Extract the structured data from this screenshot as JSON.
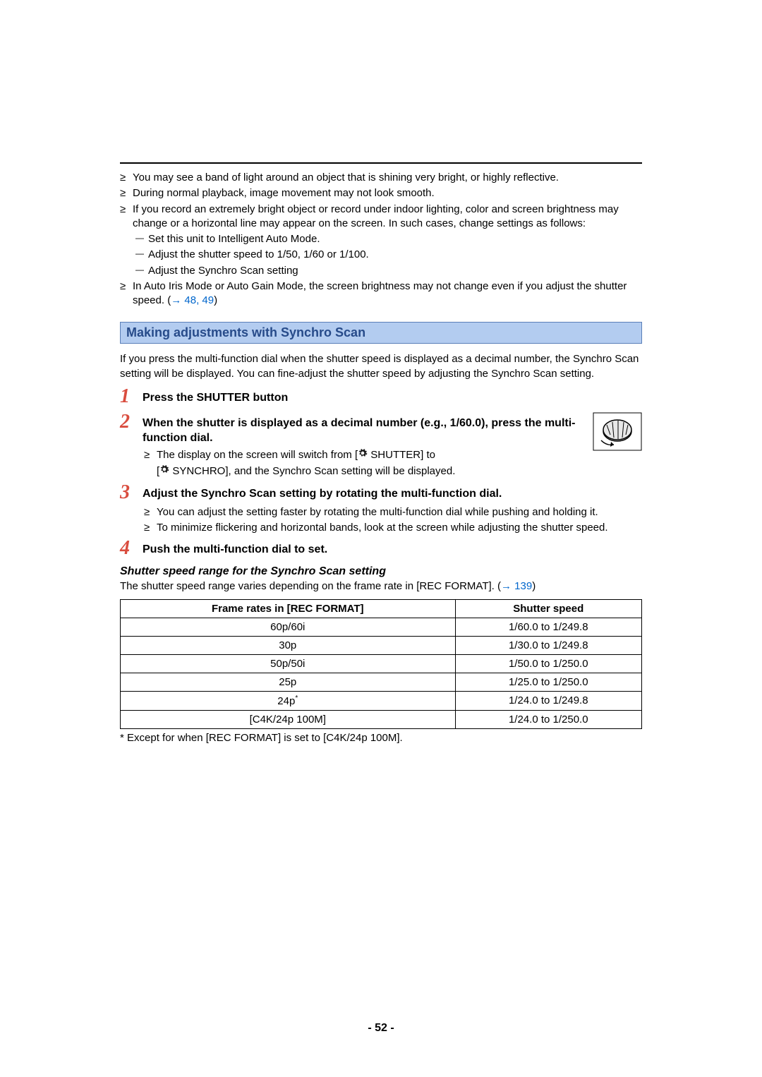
{
  "top_bullets": {
    "b1": "You may see a band of light around an object that is shining very bright, or highly reflective.",
    "b2": "During normal playback, image movement may not look smooth.",
    "b3": "If you record an extremely bright object or record under indoor lighting, color and screen brightness may change or a horizontal line may appear on the screen. In such cases, change settings as follows:",
    "b3a": "Set this unit to Intelligent Auto Mode.",
    "b3b": "Adjust the shutter speed to 1/50, 1/60 or 1/100.",
    "b3c": "Adjust the Synchro Scan setting",
    "b4": "In Auto Iris Mode or Auto Gain Mode, the screen brightness may not change even if you adjust the shutter speed. (",
    "b4_ref1": "48",
    "b4_sep": ", ",
    "b4_ref2": "49",
    "b4_close": ")",
    "arrow": "→ "
  },
  "section_heading": "Making adjustments with Synchro Scan",
  "section_para": "If you press the multi-function dial when the shutter speed is displayed as a decimal number, the Synchro Scan setting will be displayed. You can fine-adjust the shutter speed by adjusting the Synchro Scan setting.",
  "steps": {
    "n1": "1",
    "t1": "Press the SHUTTER button",
    "n2": "2",
    "t2": "When the shutter is displayed as a decimal number (e.g., 1/60.0), press the multi-function dial.",
    "s2a_pre": "The display on the screen will switch from [",
    "s2a_label": " SHUTTER] to",
    "s2b_pre": "[",
    "s2b_label": " SYNCHRO], and the Synchro Scan setting will be displayed.",
    "n3": "3",
    "t3": "Adjust the Synchro Scan setting by rotating the multi-function dial.",
    "s3a": "You can adjust the setting faster by rotating the multi-function dial while pushing and holding it.",
    "s3b": "To minimize flickering and horizontal bands, look at the screen while adjusting the shutter speed.",
    "n4": "4",
    "t4": "Push the multi-function dial to set."
  },
  "subheading": "Shutter speed range for the Synchro Scan setting",
  "sub_para": "The shutter speed range varies depending on the frame rate in [REC FORMAT]. (",
  "sub_arrow": "→ ",
  "sub_ref": "139",
  "sub_close": ")",
  "table": {
    "h1": "Frame rates in [REC FORMAT]",
    "h2": "Shutter speed",
    "rows": [
      {
        "c1": "60p/60i",
        "c2": "1/60.0 to 1/249.8"
      },
      {
        "c1": "30p",
        "c2": "1/30.0 to 1/249.8"
      },
      {
        "c1": "50p/50i",
        "c2": "1/50.0 to 1/250.0"
      },
      {
        "c1": "25p",
        "c2": "1/25.0 to 1/250.0"
      },
      {
        "c1": "24p",
        "c1_sup": "*",
        "c2": "1/24.0 to 1/249.8"
      },
      {
        "c1": "[C4K/24p 100M]",
        "c2": "1/24.0 to 1/250.0"
      }
    ]
  },
  "footnote": "*  Except for when [REC FORMAT] is set to [C4K/24p 100M].",
  "page_num": "- 52 -"
}
